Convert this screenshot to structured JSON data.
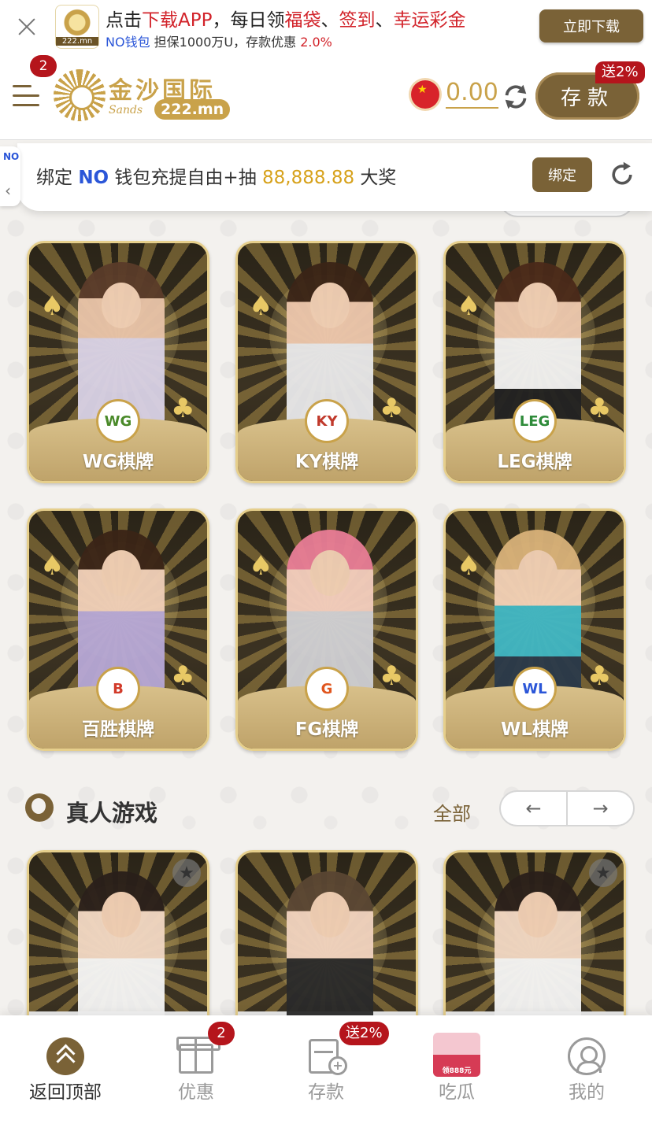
{
  "app_banner": {
    "line1_prefix": "点击",
    "line1_download": "下载APP",
    "line1_mid": "，每日领",
    "line1_bag": "福袋",
    "line1_sep1": "、",
    "line1_checkin": "签到",
    "line1_sep2": "、",
    "line1_lucky": "幸运彩金",
    "line2_no": "NO钱包",
    "line2_text": " 担保1000万U，存款优惠 ",
    "line2_pct": "2.0%",
    "logo_domain": "222.mn",
    "download_label": "立即下载"
  },
  "header": {
    "menu_badge": "2",
    "brand_name": "金沙国际",
    "brand_sands": "Sands",
    "brand_domain": "222.mn",
    "balance": "0.00",
    "deposit_label": "存款",
    "deposit_bonus": "送2%"
  },
  "notice": {
    "tab_logo": "NO",
    "tab_chevron": "‹",
    "text_prefix": "绑定 ",
    "no_logo": "NO",
    "text_mid": " 钱包充提自由+抽 ",
    "amount": "88,888.88",
    "text_suffix": " 大奖",
    "bind_label": "绑定"
  },
  "chess_games": [
    {
      "label": "WG棋牌",
      "badge": "WG"
    },
    {
      "label": "KY棋牌",
      "badge": "KY"
    },
    {
      "label": "LEG棋牌",
      "badge": "LEG"
    },
    {
      "label": "百胜棋牌",
      "badge": "B"
    },
    {
      "label": "FG棋牌",
      "badge": "G"
    },
    {
      "label": "WL棋牌",
      "badge": "WL"
    }
  ],
  "live_section": {
    "title": "真人游戏",
    "all_label": "全部",
    "prev_arrow": "←",
    "next_arrow": "→",
    "fav_icon": "★"
  },
  "bottom_nav": {
    "items": [
      {
        "label": "返回顶部"
      },
      {
        "label": "优惠",
        "badge": "2"
      },
      {
        "label": "存款",
        "badge": "送2%"
      },
      {
        "label": "吃瓜",
        "thumb_text": "领888元"
      },
      {
        "label": "我的"
      }
    ]
  },
  "colors": {
    "brand_gold": "#c9a24a",
    "brand_brown": "#7a6237",
    "badge_red": "#b5151c",
    "highlight_red": "#d2232a",
    "no_blue": "#2b56d8",
    "amount_yellow": "#d7a21c"
  },
  "icons": {
    "close": "close-icon",
    "menu": "menu-icon",
    "refresh": "refresh-icon",
    "flag": "china-flag-icon",
    "top": "back-to-top-icon",
    "gift": "gift-icon",
    "deposit": "deposit-icon",
    "profile": "profile-icon",
    "star": "star-icon"
  }
}
